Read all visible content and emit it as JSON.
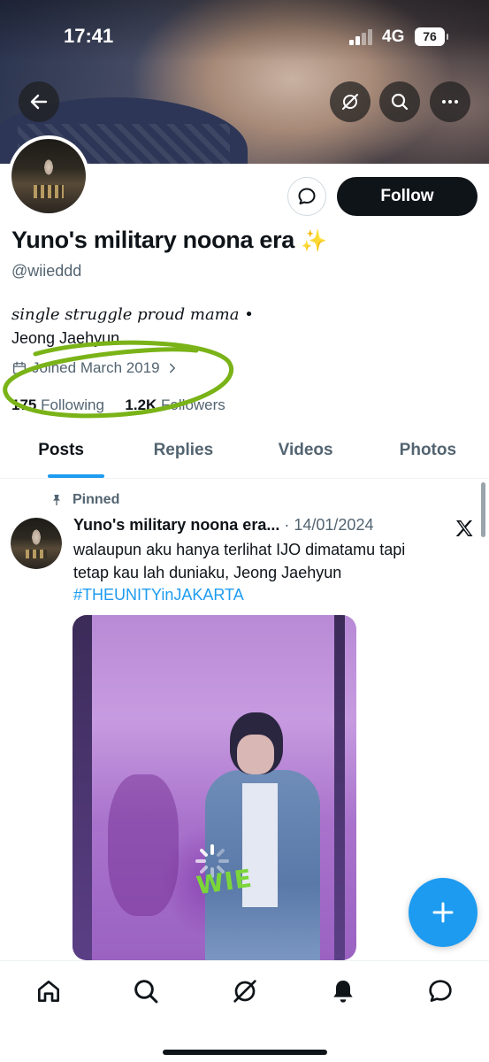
{
  "status_bar": {
    "time": "17:41",
    "network": "4G",
    "battery": "76"
  },
  "header": {
    "back_icon": "arrow-left-icon",
    "grok_icon": "grok-slash-icon",
    "search_icon": "search-icon",
    "more_icon": "more-horizontal-icon"
  },
  "profile": {
    "display_name": "Yuno's military noona era",
    "display_name_emoji": "✨",
    "handle": "@wiieddd",
    "bio_line1": "single struggle proud mama •",
    "bio_line2": "Jeong Jaehyun",
    "joined": "Joined March 2019",
    "following_count": "175",
    "following_label": "Following",
    "followers_count": "1.2K",
    "followers_label": "Followers",
    "follow_button": "Follow"
  },
  "tabs": [
    {
      "label": "Posts",
      "active": true
    },
    {
      "label": "Replies",
      "active": false
    },
    {
      "label": "Videos",
      "active": false
    },
    {
      "label": "Photos",
      "active": false
    }
  ],
  "pinned_post": {
    "pinned_label": "Pinned",
    "author": "Yuno's military noona era...",
    "separator": "·",
    "date": "14/01/2024",
    "text": "walaupun aku hanya terlihat IJO dimatamu tapi tetap kau lah duniaku, Jeong Jaehyun",
    "hashtag": "#THEUNITYinJAKARTA",
    "media_watermark": "WIE"
  },
  "bottom_nav": [
    "home-icon",
    "search-icon",
    "grok-icon",
    "notifications-icon",
    "messages-icon"
  ],
  "colors": {
    "accent": "#1d9bf0",
    "text_primary": "#0f1419",
    "text_secondary": "#536471",
    "highlight_scribble": "#7ab317"
  }
}
